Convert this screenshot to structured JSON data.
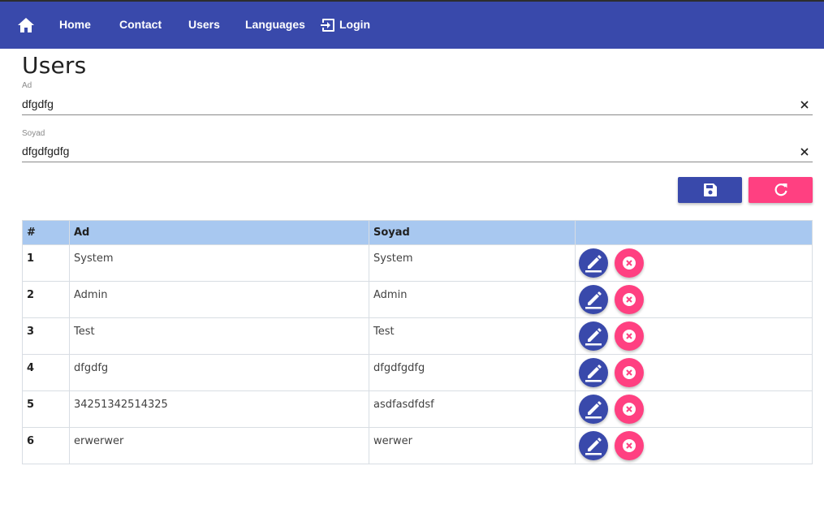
{
  "nav": {
    "home_icon": "home-icon",
    "links": [
      "Home",
      "Contact",
      "Users",
      "Languages"
    ],
    "login_label": "Login",
    "login_icon": "login-icon"
  },
  "page": {
    "title": "Users"
  },
  "form": {
    "ad": {
      "label": "Ad",
      "value": "dfgdfg"
    },
    "soyad": {
      "label": "Soyad",
      "value": "dfgdfgdfg"
    },
    "save_icon": "save-icon",
    "reset_icon": "refresh-icon"
  },
  "table": {
    "headers": [
      "#",
      "Ad",
      "Soyad",
      ""
    ],
    "rows": [
      {
        "num": "1",
        "ad": "System",
        "soyad": "System"
      },
      {
        "num": "2",
        "ad": "Admin",
        "soyad": "Admin"
      },
      {
        "num": "3",
        "ad": "Test",
        "soyad": "Test"
      },
      {
        "num": "4",
        "ad": "dfgdfg",
        "soyad": "dfgdfgdfg"
      },
      {
        "num": "5",
        "ad": "34251342514325",
        "soyad": "asdfasdfdsf"
      },
      {
        "num": "6",
        "ad": "erwerwer",
        "soyad": "werwer"
      }
    ],
    "edit_icon": "pencil-icon",
    "delete_icon": "cancel-icon"
  },
  "colors": {
    "primary": "#3949ab",
    "accent": "#ff4081",
    "header_bg": "#a8c8f0"
  }
}
